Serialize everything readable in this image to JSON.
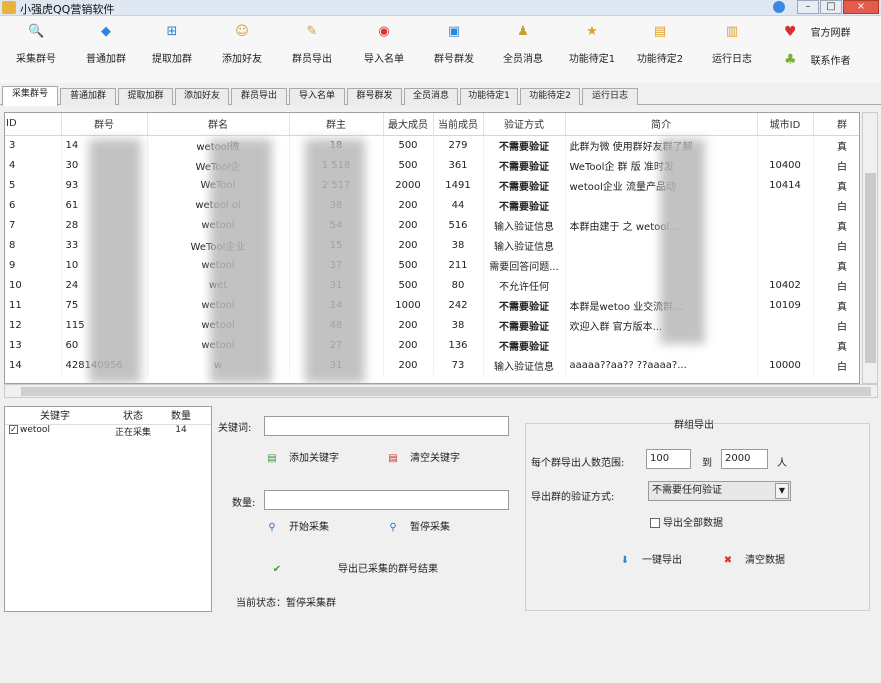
{
  "window": {
    "title": "小强虎QQ营销软件",
    "min": "–",
    "max": "□",
    "close": "×"
  },
  "toolbar": [
    {
      "label": "采集群号",
      "icon": "magnifier-icon",
      "glyph": "🔍",
      "color": "#2a78c8"
    },
    {
      "label": "普通加群",
      "icon": "diamond-icon",
      "glyph": "◆",
      "color": "#2f86d8"
    },
    {
      "label": "提取加群",
      "icon": "plus-box-icon",
      "glyph": "⊞",
      "color": "#2f86d8"
    },
    {
      "label": "添加好友",
      "icon": "users-icon",
      "glyph": "☺",
      "color": "#c9a030"
    },
    {
      "label": "群员导出",
      "icon": "pencil-icon",
      "glyph": "✎",
      "color": "#c9a030"
    },
    {
      "label": "导入名单",
      "icon": "record-icon",
      "glyph": "◉",
      "color": "#e03030"
    },
    {
      "label": "群号群发",
      "icon": "save-icon",
      "glyph": "▣",
      "color": "#2f86d8"
    },
    {
      "label": "全员消息",
      "icon": "person-icon",
      "glyph": "♟",
      "color": "#c9a030"
    },
    {
      "label": "功能待定1",
      "icon": "star-icon",
      "glyph": "★",
      "color": "#e0a020"
    },
    {
      "label": "功能待定2",
      "icon": "lock-icon",
      "glyph": "▤",
      "color": "#e0a020"
    },
    {
      "label": "运行日志",
      "icon": "book-icon",
      "glyph": "▥",
      "color": "#e0a020"
    }
  ],
  "toolbar_right": [
    {
      "label": "官方网群",
      "icon": "heart-icon",
      "glyph": "♥",
      "color": "#d83030"
    },
    {
      "label": "联系作者",
      "icon": "contact-icon",
      "glyph": "♣",
      "color": "#7ab030"
    }
  ],
  "tabs": [
    "采集群号",
    "普通加群",
    "提取加群",
    "添加好友",
    "群员导出",
    "导入名单",
    "群号群发",
    "全员消息",
    "功能待定1",
    "功能待定2",
    "运行日志"
  ],
  "table": {
    "headers": [
      "ID",
      "群号",
      "群名",
      "群主",
      "最大成员",
      "当前成员",
      "验证方式",
      "简介",
      "城市ID",
      "群"
    ],
    "rows": [
      [
        "3",
        "14",
        "wetool微",
        "18",
        "500",
        "279",
        "不需要验证",
        "此群为微  使用群好友群了解",
        "",
        "真"
      ],
      [
        "4",
        "30",
        "WeTool企",
        "1 518",
        "500",
        "361",
        "不需要验证",
        "WeTool企  群  版  准时发",
        "10400",
        "白"
      ],
      [
        "5",
        "93",
        "WeTool",
        "2 517",
        "2000",
        "1491",
        "不需要验证",
        "wetool企业  流量产品动",
        "10414",
        "真"
      ],
      [
        "6",
        "61",
        "wetool  ol",
        "38",
        "200",
        "44",
        "不需要验证",
        "",
        "",
        "白"
      ],
      [
        "7",
        "28",
        "wetool",
        "54",
        "200",
        "516",
        "输入验证信息",
        "本群由建于  之 wetool...",
        "",
        "真"
      ],
      [
        "8",
        "33",
        "WeTool企业",
        "15",
        "200",
        "38",
        "输入验证信息",
        "",
        "",
        "白"
      ],
      [
        "9",
        "10",
        "wetool",
        "37",
        "500",
        "211",
        "需要回答问题...",
        "",
        "",
        "真"
      ],
      [
        "10",
        "24",
        "wet",
        "31",
        "500",
        "80",
        "不允许任何",
        "",
        "10402",
        "白"
      ],
      [
        "11",
        "75",
        "wetool",
        "14",
        "1000",
        "242",
        "不需要验证",
        "本群是wetoo  业交流群...",
        "10109",
        "真"
      ],
      [
        "12",
        "115",
        "wetool",
        "48",
        "200",
        "38",
        "不需要验证",
        "欢迎入群  官方版本...",
        "",
        "白"
      ],
      [
        "13",
        "60",
        "wetool",
        "27",
        "200",
        "136",
        "不需要验证",
        "",
        "",
        "真"
      ],
      [
        "14",
        "428140956",
        "w",
        "31",
        "200",
        "73",
        "输入验证信息",
        "aaaaa??aa??  ??aaaa?...",
        "10000",
        "白"
      ]
    ]
  },
  "keywords": {
    "headers": [
      "关键字",
      "状态",
      "数量"
    ],
    "rows": [
      {
        "checked": true,
        "keyword": "wetool",
        "status": "正在采集",
        "count": "14"
      }
    ]
  },
  "collect": {
    "keyword_label": "关键词:",
    "keyword_value": "",
    "add_keyword": "添加关键字",
    "clear_keywords": "清空关键字",
    "count_label": "数量:",
    "count_value": "",
    "start": "开始采集",
    "pause": "暂停采集",
    "export_hint": "导出已采集的群号结果",
    "status": "当前状态：暂停采集群"
  },
  "export_group": {
    "title": "群组导出",
    "per_file_label": "每个群导出人数范围:",
    "min_value": "100",
    "to_label": "到",
    "max_value": "2000",
    "unit": "人",
    "verify_label": "导出群的验证方式:",
    "verify_value": "不需要任何验证",
    "export_all_label": "导出全部数据",
    "export_all_checked": false,
    "export_button": "一键导出",
    "clear_button": "清空数据"
  }
}
